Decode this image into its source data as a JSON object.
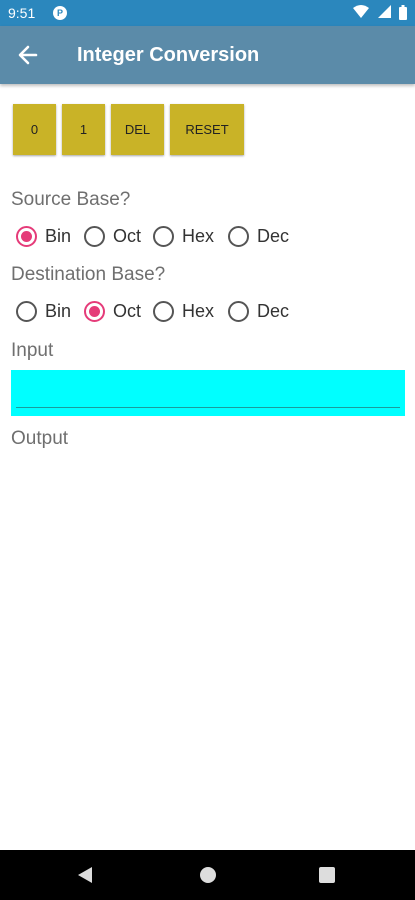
{
  "status_bar": {
    "time": "9:51",
    "app_icon": "circle-p-icon",
    "icons": [
      "wifi-icon",
      "signal-icon",
      "battery-icon"
    ]
  },
  "app_bar": {
    "title": "Integer Conversion",
    "back_icon": "arrow-left-icon"
  },
  "keypad": {
    "keys": [
      "0",
      "1",
      "DEL",
      "RESET"
    ]
  },
  "source_base": {
    "label": "Source Base?",
    "options": [
      "Bin",
      "Oct",
      "Hex",
      "Dec"
    ],
    "selected": "Bin"
  },
  "destination_base": {
    "label": "Destination Base?",
    "options": [
      "Bin",
      "Oct",
      "Hex",
      "Dec"
    ],
    "selected": "Oct"
  },
  "input": {
    "label": "Input",
    "value": ""
  },
  "output": {
    "label": "Output"
  },
  "colors": {
    "status_bar": "#2b87bd",
    "app_bar": "#5b8ba9",
    "key_bg": "#c9b327",
    "radio_accent": "#e53b79",
    "input_bg": "#00ffff"
  }
}
